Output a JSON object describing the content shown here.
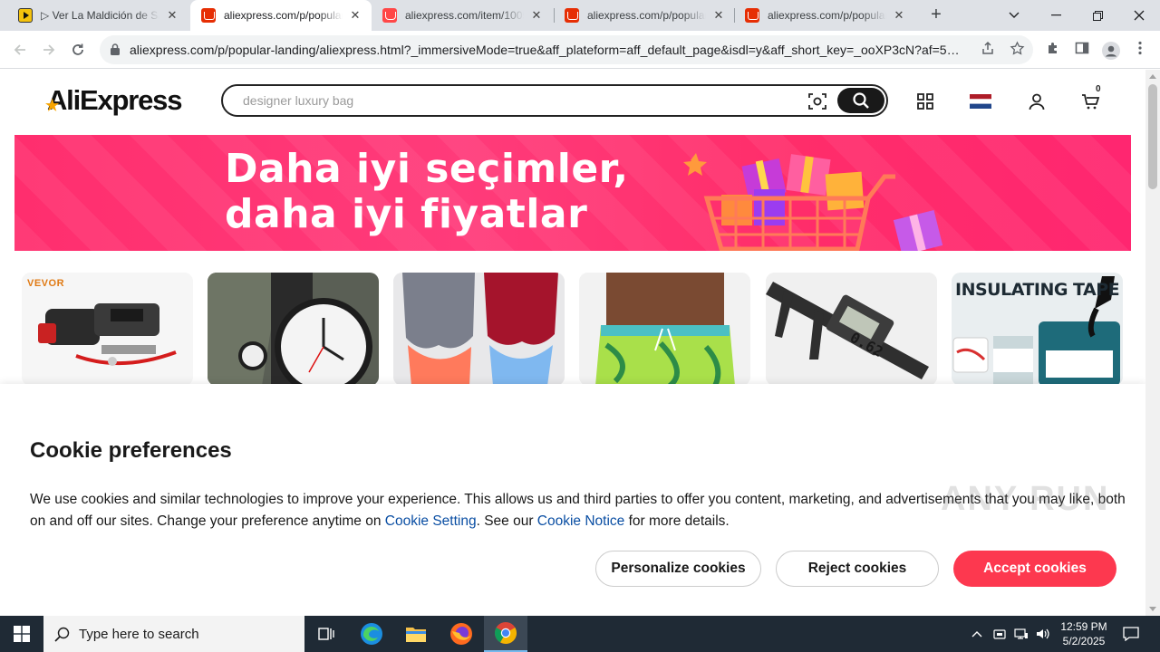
{
  "browser": {
    "tabs": [
      {
        "title": "▷ Ver La Maldición de Sayuri",
        "favicon": "yellow-play-icon",
        "active": false
      },
      {
        "title": "aliexpress.com/p/popular-landing",
        "favicon": "aliexpress-cart-icon",
        "active": true
      },
      {
        "title": "aliexpress.com/item/1005",
        "favicon": "aliexpress-app-icon",
        "active": false
      },
      {
        "title": "aliexpress.com/p/popular-landing",
        "favicon": "aliexpress-cart-icon",
        "active": false
      },
      {
        "title": "aliexpress.com/p/popular-landing",
        "favicon": "aliexpress-cart-icon",
        "active": false
      }
    ],
    "close_glyph": "✕",
    "new_tab_glyph": "+",
    "url": "aliexpress.com/p/popular-landing/aliexpress.html?_immersiveMode=true&aff_plateform=aff_default_page&isdl=y&aff_short_key=_ooXP3cN?af=5369..."
  },
  "header": {
    "logo_text": "AliExpress",
    "search_placeholder": "designer luxury bag",
    "cart_count": "0"
  },
  "banner": {
    "line1": "Daha iyi seçimler,",
    "line2": "daha iyi fiyatlar"
  },
  "products": [
    {
      "label": "VEVOR",
      "subject": "winch"
    },
    {
      "label": "",
      "subject": "watch"
    },
    {
      "label": "",
      "subject": "leggings"
    },
    {
      "label": "",
      "subject": "swim-shorts"
    },
    {
      "label": "0.62",
      "subject": "caliper"
    },
    {
      "label": "INSULATING TAPE",
      "subject": "liquid-tape"
    }
  ],
  "cookie": {
    "title": "Cookie preferences",
    "text_before": "We use cookies and similar technologies to improve your experience. This allows us and third parties to offer you content, marketing, and advertisements that you may like, both on and off our sites. Change your preference anytime on ",
    "link1": "Cookie Setting",
    "text_middle": ". See our ",
    "link2": "Cookie Notice",
    "text_after": " for more details.",
    "personalize_label": "Personalize cookies",
    "reject_label": "Reject cookies",
    "accept_label": "Accept cookies"
  },
  "watermark": "ANY RUN",
  "taskbar": {
    "search_placeholder": "Type here to search",
    "time": "12:59 PM",
    "date": "5/2/2025"
  },
  "colors": {
    "accent_red": "#fd384f",
    "banner_pink": "#ff2e6e",
    "link_blue": "#0a4ea3"
  }
}
